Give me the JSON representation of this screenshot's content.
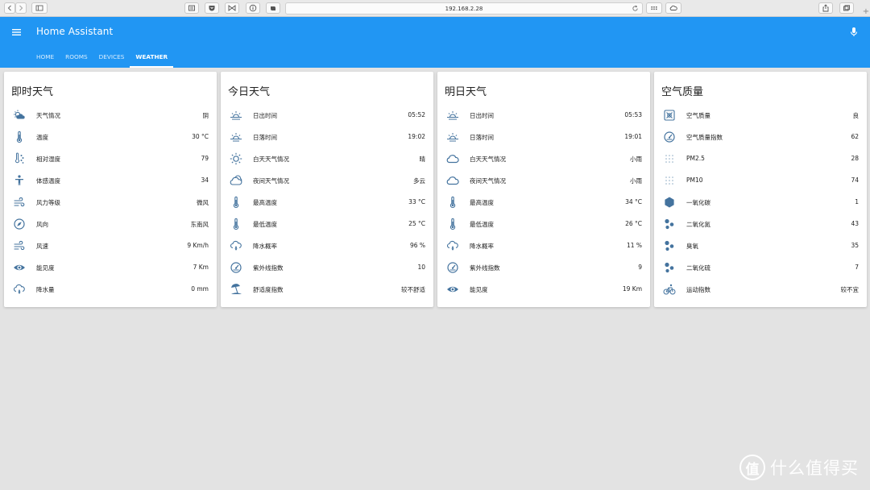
{
  "browser": {
    "url": "192.168.2.28"
  },
  "app": {
    "title": "Home Assistant",
    "accent": "#2196f3",
    "icon_color": "#44739e"
  },
  "tabs": [
    {
      "label": "HOME"
    },
    {
      "label": "ROOMS"
    },
    {
      "label": "DEVICES"
    },
    {
      "label": "WEATHER",
      "active": true
    }
  ],
  "cards": [
    {
      "title": "即时天气",
      "rows": [
        {
          "icon": "partly-cloudy-icon",
          "label": "天气情况",
          "value": "阴"
        },
        {
          "icon": "thermometer-icon",
          "label": "温度",
          "value": "30 °C"
        },
        {
          "icon": "humidity-icon",
          "label": "相对湿度",
          "value": "79"
        },
        {
          "icon": "person-icon",
          "label": "体感温度",
          "value": "34"
        },
        {
          "icon": "wind-icon",
          "label": "风力等级",
          "value": "微风"
        },
        {
          "icon": "compass-icon",
          "label": "风向",
          "value": "东南风"
        },
        {
          "icon": "wind-icon",
          "label": "风速",
          "value": "9 Km/h"
        },
        {
          "icon": "eye-icon",
          "label": "能见度",
          "value": "7 Km"
        },
        {
          "icon": "rain-cloud-icon",
          "label": "降水量",
          "value": "0 mm"
        }
      ]
    },
    {
      "title": "今日天气",
      "rows": [
        {
          "icon": "sunrise-icon",
          "label": "日出时间",
          "value": "05:52"
        },
        {
          "icon": "sunset-icon",
          "label": "日落时间",
          "value": "19:02"
        },
        {
          "icon": "sun-icon",
          "label": "白天天气情况",
          "value": "晴"
        },
        {
          "icon": "cloudy-icon",
          "label": "夜间天气情况",
          "value": "多云"
        },
        {
          "icon": "thermometer-icon",
          "label": "最高温度",
          "value": "33 °C"
        },
        {
          "icon": "thermometer-icon",
          "label": "最低温度",
          "value": "25 °C"
        },
        {
          "icon": "rain-cloud-icon",
          "label": "降水概率",
          "value": "96 %"
        },
        {
          "icon": "gauge-icon",
          "label": "紫外线指数",
          "value": "10"
        },
        {
          "icon": "beach-icon",
          "label": "舒适度指数",
          "value": "较不舒适"
        }
      ]
    },
    {
      "title": "明日天气",
      "rows": [
        {
          "icon": "sunrise-icon",
          "label": "日出时间",
          "value": "05:53"
        },
        {
          "icon": "sunset-icon",
          "label": "日落时间",
          "value": "19:01"
        },
        {
          "icon": "cloud-icon",
          "label": "白天天气情况",
          "value": "小雨"
        },
        {
          "icon": "cloud-icon",
          "label": "夜间天气情况",
          "value": "小雨"
        },
        {
          "icon": "thermometer-icon",
          "label": "最高温度",
          "value": "34 °C"
        },
        {
          "icon": "thermometer-icon",
          "label": "最低温度",
          "value": "26 °C"
        },
        {
          "icon": "rain-cloud-icon",
          "label": "降水概率",
          "value": "11 %"
        },
        {
          "icon": "gauge-icon",
          "label": "紫外线指数",
          "value": "9"
        },
        {
          "icon": "eye-icon",
          "label": "能见度",
          "value": "19 Km"
        }
      ]
    },
    {
      "title": "空气质量",
      "rows": [
        {
          "icon": "air-filter-icon",
          "label": "空气质量",
          "value": "良"
        },
        {
          "icon": "gauge-icon",
          "label": "空气质量指数",
          "value": "62"
        },
        {
          "icon": "dots-grid-icon",
          "label": "PM2.5",
          "value": "28"
        },
        {
          "icon": "dots-grid-icon",
          "label": "PM10",
          "value": "74"
        },
        {
          "icon": "hexagon-icon",
          "label": "一氧化碳",
          "value": "1"
        },
        {
          "icon": "molecule-icon",
          "label": "二氧化氮",
          "value": "43"
        },
        {
          "icon": "molecule-icon",
          "label": "臭氧",
          "value": "35"
        },
        {
          "icon": "molecule-icon",
          "label": "二氧化硫",
          "value": "7"
        },
        {
          "icon": "bike-icon",
          "label": "运动指数",
          "value": "较不宜"
        }
      ]
    }
  ],
  "watermark": {
    "logo": "值",
    "text": "什么值得买"
  }
}
